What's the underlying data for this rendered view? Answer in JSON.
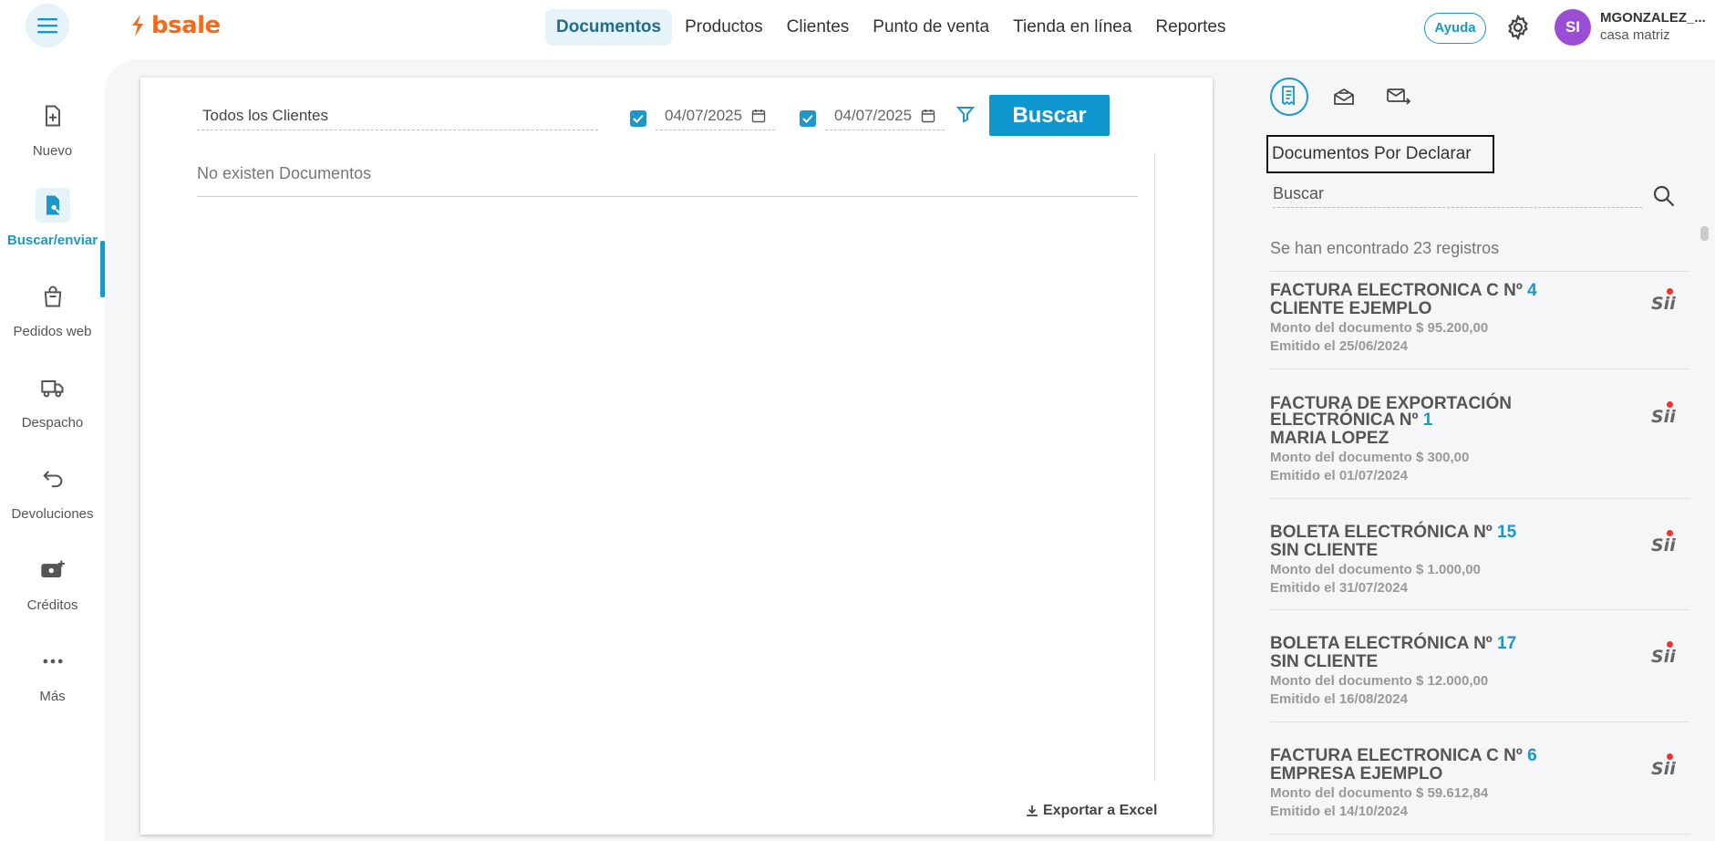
{
  "topbar": {
    "brand": "bsale",
    "nav": [
      "Documentos",
      "Productos",
      "Clientes",
      "Punto de venta",
      "Tienda en línea",
      "Reportes"
    ],
    "help": "Ayuda",
    "avatar_initials": "SI",
    "user_name": "MGONZALEZ_...",
    "user_branch": "casa matriz"
  },
  "sidebar": {
    "items": [
      {
        "label": "Nuevo",
        "icon": "file-plus-icon"
      },
      {
        "label": "Buscar/enviar",
        "icon": "file-search-icon"
      },
      {
        "label": "Pedidos web",
        "icon": "shopping-bag-icon"
      },
      {
        "label": "Despacho",
        "icon": "truck-icon"
      },
      {
        "label": "Devoluciones",
        "icon": "return-arrow-icon"
      },
      {
        "label": "Créditos",
        "icon": "money-plus-icon"
      },
      {
        "label": "Más",
        "icon": "more-dots-icon"
      }
    ]
  },
  "search": {
    "clients": "Todos los Clientes",
    "date_from": "04/07/2025",
    "date_to": "04/07/2025",
    "button": "Buscar"
  },
  "results": {
    "empty": "No existen Documentos",
    "export": "Exportar a Excel"
  },
  "right_panel": {
    "title": "Documentos Por Declarar",
    "search_placeholder": "Buscar",
    "count": "Se han encontrado 23 registros",
    "docs": [
      {
        "title": "FACTURA ELECTRONICA C Nº ",
        "num": "4",
        "client": "CLIENTE EJEMPLO",
        "amount": "Monto del documento $ 95.200,00",
        "date": "Emitido el 25/06/2024"
      },
      {
        "title": "FACTURA DE EXPORTACIÓN ELECTRÓNICA Nº ",
        "num": "1",
        "client": "MARIA LOPEZ",
        "amount": "Monto del documento $ 300,00",
        "date": "Emitido el 01/07/2024"
      },
      {
        "title": "BOLETA ELECTRÓNICA Nº ",
        "num": "15",
        "client": "SIN CLIENTE",
        "amount": "Monto del documento $ 1.000,00",
        "date": "Emitido el 31/07/2024"
      },
      {
        "title": "BOLETA ELECTRÓNICA Nº ",
        "num": "17",
        "client": "SIN CLIENTE",
        "amount": "Monto del documento $ 12.000,00",
        "date": "Emitido el 16/08/2024"
      },
      {
        "title": "FACTURA ELECTRONICA C Nº ",
        "num": "6",
        "client": "EMPRESA EJEMPLO",
        "amount": "Monto del documento $ 59.612,84",
        "date": "Emitido el 14/10/2024"
      }
    ],
    "sii_label": "Sii"
  }
}
